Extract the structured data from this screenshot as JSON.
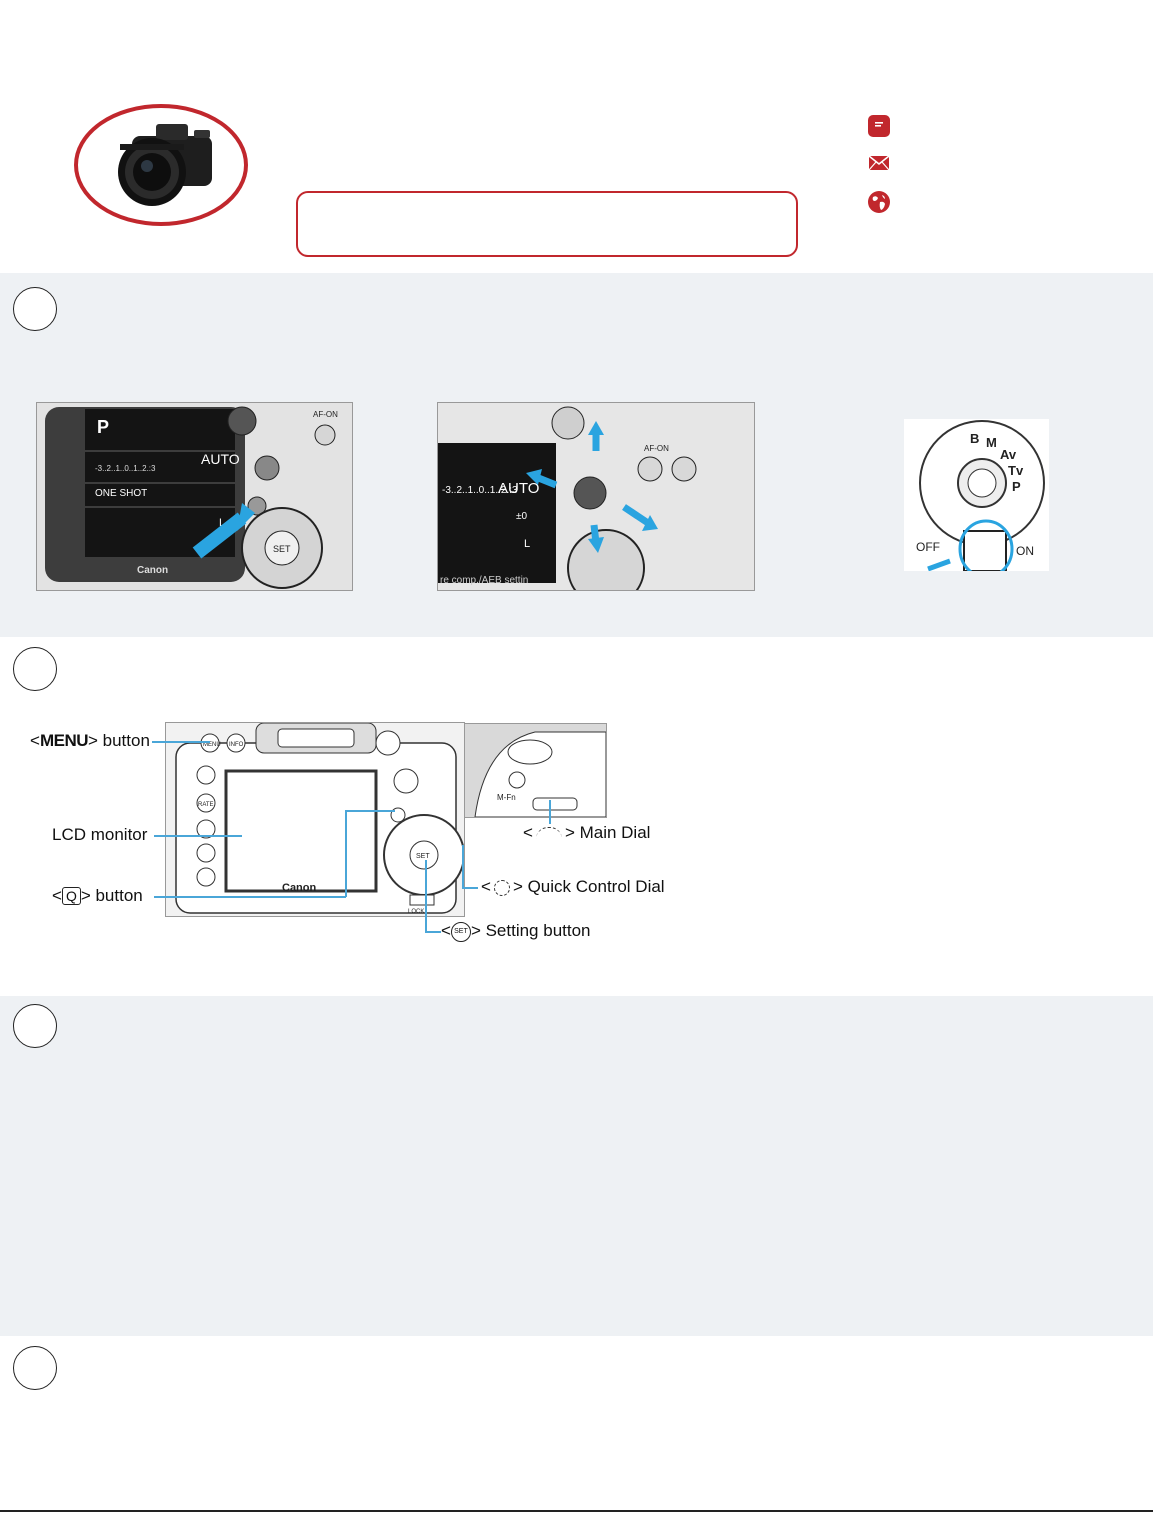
{
  "header": {
    "product_image_icon": "camera-body-icon",
    "contact_icons": [
      "chat-icon",
      "email-icon",
      "globe-icon"
    ],
    "accent_color": "#c1272d"
  },
  "step1": {
    "figures": [
      "quick-control-button-figure",
      "multi-controller-figure",
      "mode-dial-power-switch-figure"
    ],
    "screen_labels": {
      "mode": "P",
      "iso": "AUTO",
      "drive": "ONE SHOT",
      "brand": "Canon",
      "meter": "-3..2..1..0..1..2.:3",
      "af_on": "AF-ON",
      "set": "SET",
      "exp_comp": "±0",
      "size": "L",
      "bottom_text": "re comp./AEB settin",
      "dial_modes": [
        "B",
        "M",
        "Av",
        "Tv",
        "P"
      ],
      "off": "OFF",
      "on": "ON"
    }
  },
  "step2": {
    "callouts": {
      "menu_prefix": "<",
      "menu_word": "MENU",
      "menu_suffix": "> button",
      "lcd": "LCD monitor",
      "q_prefix": "<",
      "q_word": "Q",
      "q_suffix": "> button",
      "main_dial": "> Main Dial",
      "main_dial_prefix": "<",
      "qcd_prefix": "<",
      "qcd": "> Quick Control Dial",
      "set_prefix": "<",
      "set_word": "SET",
      "set_suffix": "> Setting button"
    },
    "body_labels": {
      "brand": "Canon",
      "menu": "MENU",
      "info": "INFO",
      "rate": "RATE",
      "mfn": "M-Fn",
      "lock": "LOCK",
      "set": "SET"
    }
  }
}
